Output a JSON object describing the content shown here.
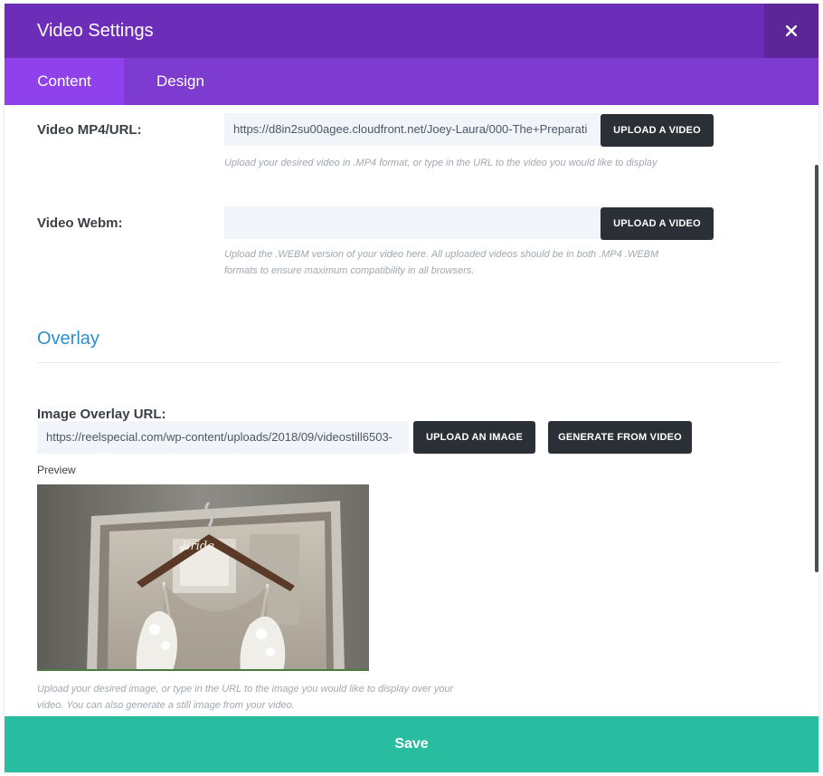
{
  "header": {
    "title": "Video Settings"
  },
  "tabs": [
    {
      "label": "Content",
      "active": true
    },
    {
      "label": "Design",
      "active": false
    }
  ],
  "fields": {
    "mp4": {
      "label": "Video MP4/URL:",
      "value": "https://d8in2su00agee.cloudfront.net/Joey-Laura/000-The+Preparati",
      "button": "UPLOAD A VIDEO",
      "help": "Upload your desired video in .MP4 format, or type in the URL to the video you would like to display"
    },
    "webm": {
      "label": "Video Webm:",
      "value": "",
      "button": "UPLOAD A VIDEO",
      "help_line1": "Upload the .WEBM version of your video here. All uploaded videos should be in both .MP4 .WEBM",
      "help_line2": "formats to ensure maximum compatibility in all browsers."
    }
  },
  "overlay": {
    "section_title": "Overlay",
    "label": "Image Overlay URL:",
    "value": "https://reelspecial.com/wp-content/uploads/2018/09/videostill6503-",
    "upload_button": "UPLOAD AN IMAGE",
    "generate_button": "GENERATE FROM VIDEO",
    "preview_label": "Preview",
    "hanger_text": "Bride",
    "help_line1": "Upload your desired image, or type in the URL to the image you would like to display over your",
    "help_line2": "video. You can also generate a still image from your video."
  },
  "footer": {
    "save_label": "Save"
  },
  "colors": {
    "header": "#6c2eb9",
    "tabs": "#7d3bcf",
    "active_tab": "#8f42ec",
    "save": "#28bca0",
    "section_title": "#2e8ec7"
  }
}
